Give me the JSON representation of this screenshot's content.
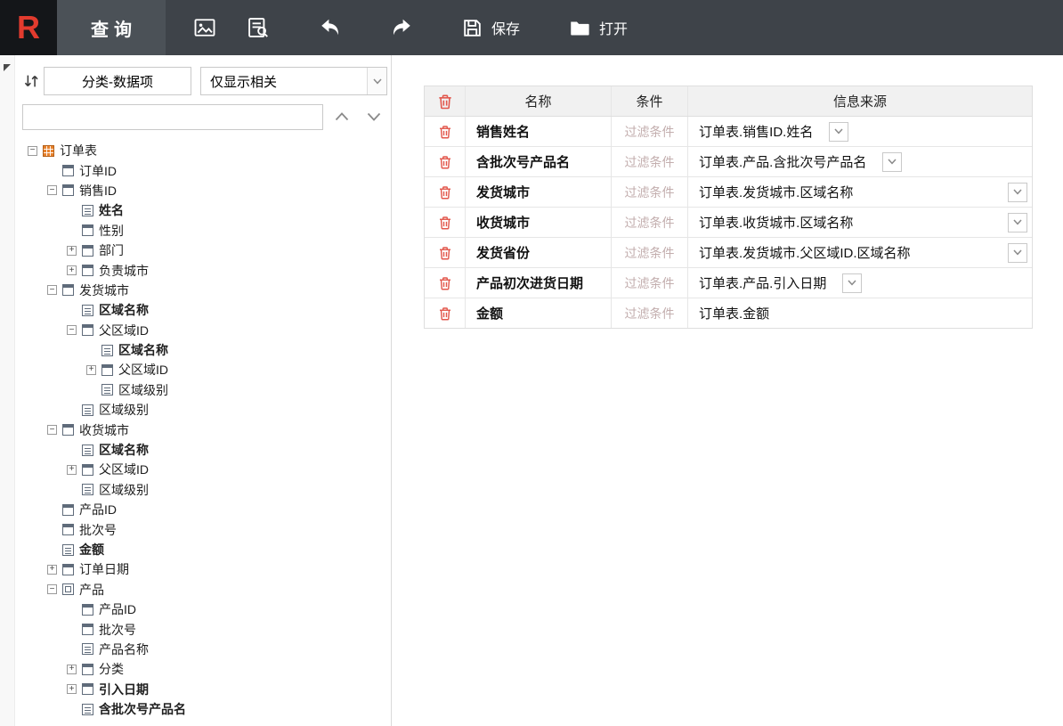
{
  "topbar": {
    "logo_letter": "R",
    "active_tab": "查询",
    "save_label": "保存",
    "open_label": "打开"
  },
  "sidebar": {
    "category_button": "分类-数据项",
    "relevance_select": "仅显示相关",
    "search_value": "",
    "tree": [
      {
        "level": 0,
        "exp": "minus",
        "icon": "table",
        "label": "订单表",
        "bold": false
      },
      {
        "level": 1,
        "exp": "none",
        "icon": "window",
        "label": "订单ID",
        "bold": false
      },
      {
        "level": 1,
        "exp": "minus",
        "icon": "window",
        "label": "销售ID",
        "bold": false
      },
      {
        "level": 2,
        "exp": "none",
        "icon": "list",
        "label": "姓名",
        "bold": true
      },
      {
        "level": 2,
        "exp": "none",
        "icon": "window",
        "label": "性别",
        "bold": false
      },
      {
        "level": 2,
        "exp": "plus",
        "icon": "window",
        "label": "部门",
        "bold": false
      },
      {
        "level": 2,
        "exp": "plus",
        "icon": "window",
        "label": "负责城市",
        "bold": false
      },
      {
        "level": 1,
        "exp": "minus",
        "icon": "window",
        "label": "发货城市",
        "bold": false
      },
      {
        "level": 2,
        "exp": "none",
        "icon": "list",
        "label": "区域名称",
        "bold": true
      },
      {
        "level": 2,
        "exp": "minus",
        "icon": "window",
        "label": "父区域ID",
        "bold": false
      },
      {
        "level": 3,
        "exp": "none",
        "icon": "list",
        "label": "区域名称",
        "bold": true
      },
      {
        "level": 3,
        "exp": "plus",
        "icon": "window",
        "label": "父区域ID",
        "bold": false
      },
      {
        "level": 3,
        "exp": "none",
        "icon": "list",
        "label": "区域级别",
        "bold": false
      },
      {
        "level": 2,
        "exp": "none",
        "icon": "list",
        "label": "区域级别",
        "bold": false
      },
      {
        "level": 1,
        "exp": "minus",
        "icon": "window",
        "label": "收货城市",
        "bold": false
      },
      {
        "level": 2,
        "exp": "none",
        "icon": "list",
        "label": "区域名称",
        "bold": true
      },
      {
        "level": 2,
        "exp": "plus",
        "icon": "window",
        "label": "父区域ID",
        "bold": false
      },
      {
        "level": 2,
        "exp": "none",
        "icon": "list",
        "label": "区域级别",
        "bold": false
      },
      {
        "level": 1,
        "exp": "none",
        "icon": "window",
        "label": "产品ID",
        "bold": false
      },
      {
        "level": 1,
        "exp": "none",
        "icon": "window",
        "label": "批次号",
        "bold": false
      },
      {
        "level": 1,
        "exp": "none",
        "icon": "list",
        "label": "金额",
        "bold": true
      },
      {
        "level": 1,
        "exp": "plus",
        "icon": "window",
        "label": "订单日期",
        "bold": false
      },
      {
        "level": 1,
        "exp": "minus",
        "icon": "product",
        "label": "产品",
        "bold": false
      },
      {
        "level": 2,
        "exp": "none",
        "icon": "window",
        "label": "产品ID",
        "bold": false
      },
      {
        "level": 2,
        "exp": "none",
        "icon": "window",
        "label": "批次号",
        "bold": false
      },
      {
        "level": 2,
        "exp": "none",
        "icon": "list",
        "label": "产品名称",
        "bold": false
      },
      {
        "level": 2,
        "exp": "plus",
        "icon": "window",
        "label": "分类",
        "bold": false
      },
      {
        "level": 2,
        "exp": "plus",
        "icon": "window",
        "label": "引入日期",
        "bold": true
      },
      {
        "level": 2,
        "exp": "none",
        "icon": "list",
        "label": "含批次号产品名",
        "bold": true
      }
    ]
  },
  "main_table": {
    "headers": {
      "name": "名称",
      "condition": "条件",
      "source": "信息来源"
    },
    "condition_text": "过滤条件",
    "rows": [
      {
        "name": "销售姓名",
        "source": "订单表.销售ID.姓名",
        "dropdown": "inline"
      },
      {
        "name": "含批次号产品名",
        "source": "订单表.产品.含批次号产品名",
        "dropdown": "inline"
      },
      {
        "name": "发货城市",
        "source": "订单表.发货城市.区域名称",
        "dropdown": "right"
      },
      {
        "name": "收货城市",
        "source": "订单表.收货城市.区域名称",
        "dropdown": "right"
      },
      {
        "name": "发货省份",
        "source": "订单表.发货城市.父区域ID.区域名称",
        "dropdown": "right"
      },
      {
        "name": "产品初次进货日期",
        "source": "订单表.产品.引入日期",
        "dropdown": "inline"
      },
      {
        "name": "金额",
        "source": "订单表.金额",
        "dropdown": "none"
      }
    ]
  },
  "colors": {
    "topbar_bg": "#3e4349",
    "logo_bg": "#141619",
    "logo_red": "#e23b2e",
    "trash_red": "#e2574c",
    "condition_text": "#c3aeae"
  }
}
